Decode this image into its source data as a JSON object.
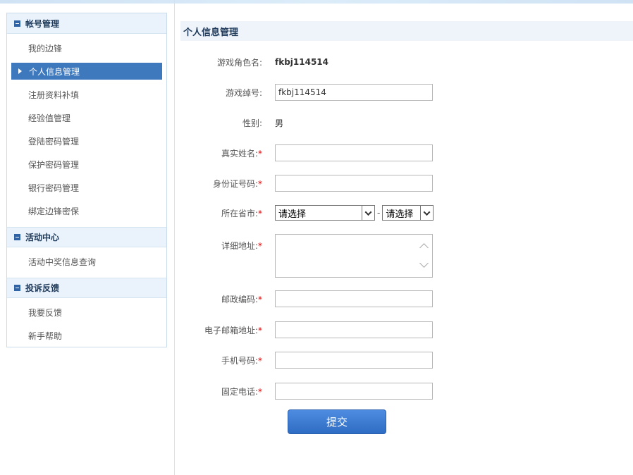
{
  "sidebar": {
    "sections": [
      {
        "title": "帐号管理",
        "items": [
          "我的边锋",
          "个人信息管理",
          "注册资料补填",
          "经验值管理",
          "登陆密码管理",
          "保护密码管理",
          "银行密码管理",
          "绑定边锋密保"
        ],
        "active": 1
      },
      {
        "title": "活动中心",
        "items": [
          "活动中奖信息查询"
        ]
      },
      {
        "title": "投诉反馈",
        "items": [
          "我要反馈",
          "新手帮助"
        ]
      }
    ]
  },
  "main": {
    "title": "个人信息管理",
    "fields": {
      "role_name": {
        "label": "游戏角色名:",
        "value": "fkbj114514"
      },
      "nickname": {
        "label": "游戏绰号:",
        "value": "fkbj114514"
      },
      "gender": {
        "label": "性别:",
        "value": "男"
      },
      "real_name": {
        "label": "真实姓名:",
        "value": ""
      },
      "id_number": {
        "label": "身份证号码:",
        "value": ""
      },
      "province": {
        "label": "所在省市:",
        "province_value": "请选择",
        "city_value": "请选择"
      },
      "address": {
        "label": "详细地址:",
        "value": ""
      },
      "postcode": {
        "label": "邮政编码:",
        "value": ""
      },
      "email": {
        "label": "电子邮箱地址:",
        "value": ""
      },
      "mobile": {
        "label": "手机号码:",
        "value": ""
      },
      "phone": {
        "label": "固定电话:",
        "value": ""
      }
    },
    "required_mark": "*",
    "separator": "-",
    "submit_label": "提交"
  }
}
